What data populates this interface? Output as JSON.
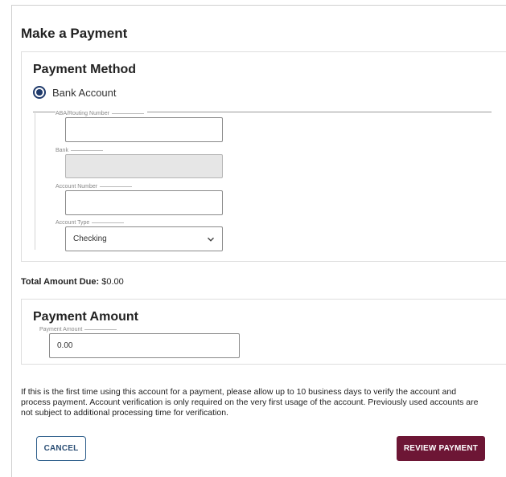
{
  "page": {
    "title": "Make a Payment"
  },
  "payment_method": {
    "title": "Payment Method",
    "option_label": "Bank Account",
    "selected": true,
    "fields": {
      "routing": {
        "label": "ABA/Routing Number",
        "value": ""
      },
      "bank": {
        "label": "Bank",
        "value": ""
      },
      "account_number": {
        "label": "Account Number",
        "value": ""
      },
      "account_type": {
        "label": "Account Type",
        "value": "Checking"
      }
    }
  },
  "total_due": {
    "label": "Total Amount Due:",
    "value": "$0.00"
  },
  "payment_amount": {
    "title": "Payment Amount",
    "field_label": "Payment Amount",
    "value": "0.00"
  },
  "notice": "If this is the first time using this account for a payment, please allow up to 10 business days to verify the account and process payment. Account verification is only required on the very first usage of the account. Previously used accounts are not subject to additional processing time for verification.",
  "actions": {
    "cancel_label": "CANCEL",
    "review_label": "REVIEW PAYMENT"
  },
  "colors": {
    "accent": "#6d1635",
    "radio": "#1f3a6b",
    "cancel_border": "#2c5d8a"
  },
  "icons": {
    "select": "chevron-down-icon"
  }
}
